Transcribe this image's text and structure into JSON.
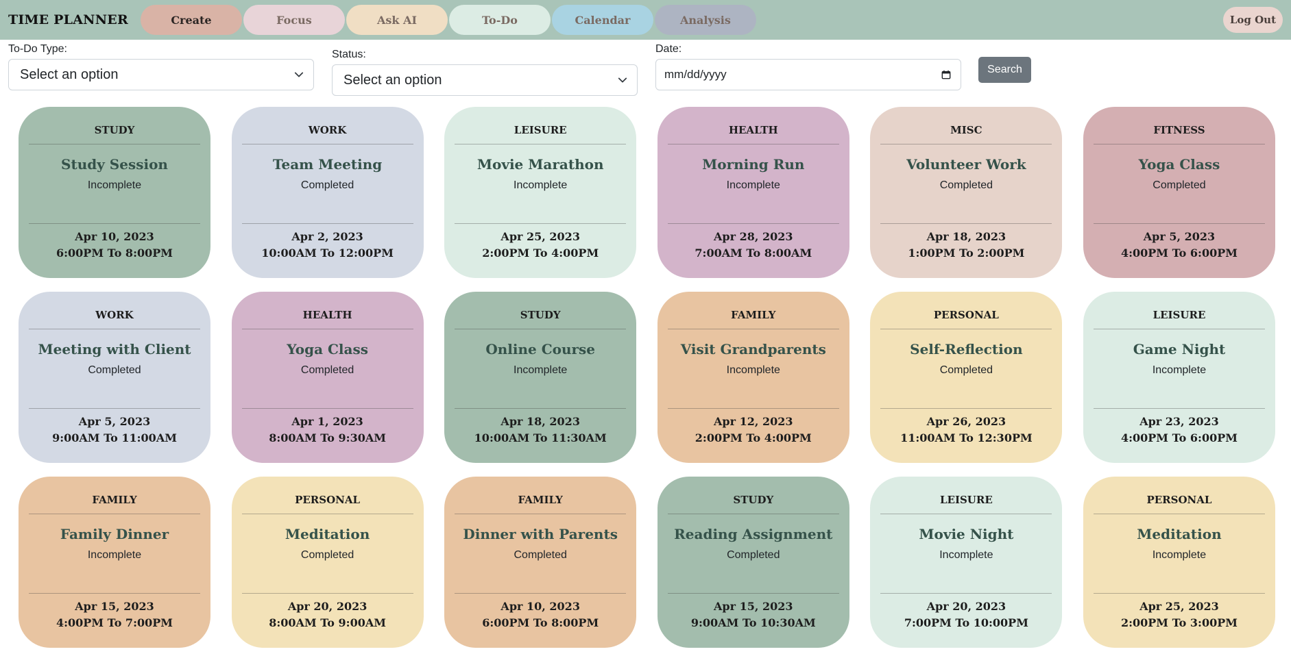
{
  "header": {
    "brand": "TIME PLANNER",
    "tabs": [
      {
        "label": "Create"
      },
      {
        "label": "Focus"
      },
      {
        "label": "Ask AI"
      },
      {
        "label": "To-Do"
      },
      {
        "label": "Calendar"
      },
      {
        "label": "Analysis"
      }
    ],
    "logout": "Log Out"
  },
  "filters": {
    "type_label": "To-Do Type:",
    "type_value": "Select an option",
    "status_label": "Status:",
    "status_value": "Select an option",
    "date_label": "Date:",
    "date_value": "mm/dd/yyyy",
    "search_label": "Search"
  },
  "colors": {
    "STUDY": "#a3bdad",
    "WORK": "#d3d9e4",
    "LEISURE": "#dcece4",
    "HEALTH": "#d3b4ca",
    "MISC": "#e6d3ca",
    "FITNESS": "#d4afb2",
    "FAMILY": "#e8c4a1",
    "PERSONAL": "#f3e2b8"
  },
  "todos": [
    {
      "type": "STUDY",
      "title": "Study Session",
      "status": "Incomplete",
      "date": "Apr 10, 2023",
      "time": "6:00PM To 8:00PM"
    },
    {
      "type": "WORK",
      "title": "Team Meeting",
      "status": "Completed",
      "date": "Apr 2, 2023",
      "time": "10:00AM To 12:00PM"
    },
    {
      "type": "LEISURE",
      "title": "Movie Marathon",
      "status": "Incomplete",
      "date": "Apr 25, 2023",
      "time": "2:00PM To 4:00PM"
    },
    {
      "type": "HEALTH",
      "title": "Morning Run",
      "status": "Incomplete",
      "date": "Apr 28, 2023",
      "time": "7:00AM To 8:00AM"
    },
    {
      "type": "MISC",
      "title": "Volunteer Work",
      "status": "Completed",
      "date": "Apr 18, 2023",
      "time": "1:00PM To 2:00PM"
    },
    {
      "type": "FITNESS",
      "title": "Yoga Class",
      "status": "Completed",
      "date": "Apr 5, 2023",
      "time": "4:00PM To 6:00PM"
    },
    {
      "type": "WORK",
      "title": "Meeting with Client",
      "status": "Completed",
      "date": "Apr 5, 2023",
      "time": "9:00AM To 11:00AM"
    },
    {
      "type": "HEALTH",
      "title": "Yoga Class",
      "status": "Completed",
      "date": "Apr 1, 2023",
      "time": "8:00AM To 9:30AM"
    },
    {
      "type": "STUDY",
      "title": "Online Course",
      "status": "Incomplete",
      "date": "Apr 18, 2023",
      "time": "10:00AM To 11:30AM"
    },
    {
      "type": "FAMILY",
      "title": "Visit Grandparents",
      "status": "Incomplete",
      "date": "Apr 12, 2023",
      "time": "2:00PM To 4:00PM"
    },
    {
      "type": "PERSONAL",
      "title": "Self-Reflection",
      "status": "Completed",
      "date": "Apr 26, 2023",
      "time": "11:00AM To 12:30PM"
    },
    {
      "type": "LEISURE",
      "title": "Game Night",
      "status": "Incomplete",
      "date": "Apr 23, 2023",
      "time": "4:00PM To 6:00PM"
    },
    {
      "type": "FAMILY",
      "title": "Family Dinner",
      "status": "Incomplete",
      "date": "Apr 15, 2023",
      "time": "4:00PM To 7:00PM"
    },
    {
      "type": "PERSONAL",
      "title": "Meditation",
      "status": "Completed",
      "date": "Apr 20, 2023",
      "time": "8:00AM To 9:00AM"
    },
    {
      "type": "FAMILY",
      "title": "Dinner with Parents",
      "status": "Completed",
      "date": "Apr 10, 2023",
      "time": "6:00PM To 8:00PM"
    },
    {
      "type": "STUDY",
      "title": "Reading Assignment",
      "status": "Completed",
      "date": "Apr 15, 2023",
      "time": "9:00AM To 10:30AM"
    },
    {
      "type": "LEISURE",
      "title": "Movie Night",
      "status": "Incomplete",
      "date": "Apr 20, 2023",
      "time": "7:00PM To 10:00PM"
    },
    {
      "type": "PERSONAL",
      "title": "Meditation",
      "status": "Incomplete",
      "date": "Apr 25, 2023",
      "time": "2:00PM To 3:00PM"
    }
  ]
}
